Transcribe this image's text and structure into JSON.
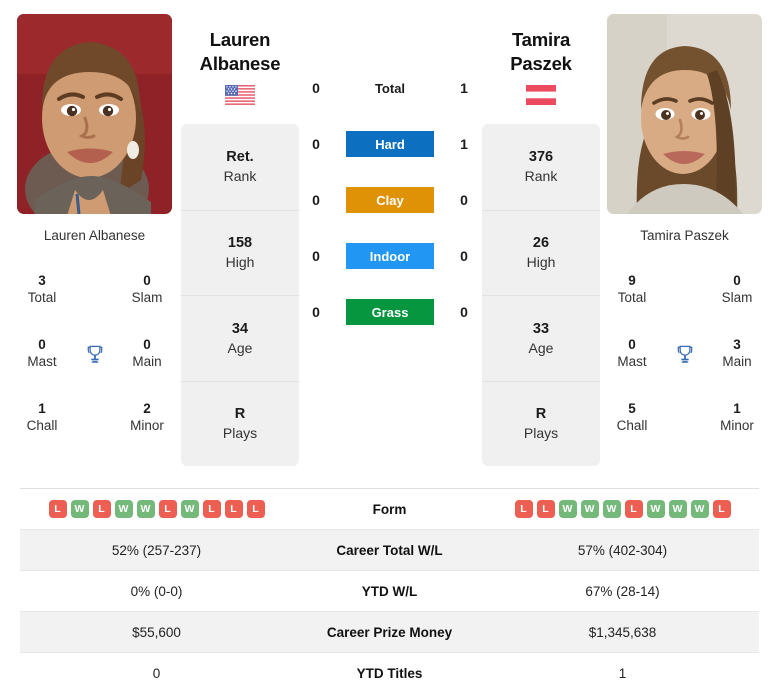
{
  "players": {
    "left": {
      "first_name": "Lauren",
      "last_name": "Albanese",
      "full_name": "Lauren Albanese",
      "country": "USA",
      "flag_icon": "flag-usa-icon",
      "photo_alt": "lauren-albanese-photo",
      "titles": {
        "total_value": "3",
        "total_label": "Total",
        "slam_value": "0",
        "slam_label": "Slam",
        "mast_value": "0",
        "mast_label": "Mast",
        "main_value": "0",
        "main_label": "Main",
        "chall_value": "1",
        "chall_label": "Chall",
        "minor_value": "2",
        "minor_label": "Minor",
        "trophy_icon": "trophy-icon"
      },
      "info": [
        {
          "value": "Ret.",
          "label": "Rank"
        },
        {
          "value": "158",
          "label": "High"
        },
        {
          "value": "34",
          "label": "Age"
        },
        {
          "value": "R",
          "label": "Plays"
        }
      ],
      "form": [
        "L",
        "W",
        "L",
        "W",
        "W",
        "L",
        "W",
        "L",
        "L",
        "L"
      ],
      "career_total_wl": "52% (257-237)",
      "ytd_wl": "0% (0-0)",
      "career_prize_money": "$55,600",
      "ytd_titles": "0"
    },
    "right": {
      "first_name": "Tamira",
      "last_name": "Paszek",
      "full_name": "Tamira Paszek",
      "country": "AUT",
      "flag_icon": "flag-austria-icon",
      "photo_alt": "tamira-paszek-photo",
      "titles": {
        "total_value": "9",
        "total_label": "Total",
        "slam_value": "0",
        "slam_label": "Slam",
        "mast_value": "0",
        "mast_label": "Mast",
        "main_value": "3",
        "main_label": "Main",
        "chall_value": "5",
        "chall_label": "Chall",
        "minor_value": "1",
        "minor_label": "Minor",
        "trophy_icon": "trophy-icon"
      },
      "info": [
        {
          "value": "376",
          "label": "Rank"
        },
        {
          "value": "26",
          "label": "High"
        },
        {
          "value": "33",
          "label": "Age"
        },
        {
          "value": "R",
          "label": "Plays"
        }
      ],
      "form": [
        "L",
        "L",
        "W",
        "W",
        "W",
        "L",
        "W",
        "W",
        "W",
        "L"
      ],
      "career_total_wl": "57% (402-304)",
      "ytd_wl": "67% (28-14)",
      "career_prize_money": "$1,345,638",
      "ytd_titles": "1"
    }
  },
  "head_to_head": {
    "total": {
      "label": "Total",
      "left": "0",
      "right": "1"
    },
    "surfaces": [
      {
        "label": "Hard",
        "left": "0",
        "right": "1",
        "color": "#0d6fbf"
      },
      {
        "label": "Clay",
        "left": "0",
        "right": "0",
        "color": "#e09207"
      },
      {
        "label": "Indoor",
        "left": "0",
        "right": "0",
        "color": "#2196f3"
      },
      {
        "label": "Grass",
        "left": "0",
        "right": "0",
        "color": "#069640"
      }
    ]
  },
  "stats_table": {
    "rows": [
      {
        "label": "Form",
        "key": "form",
        "type": "form"
      },
      {
        "label": "Career Total W/L",
        "key": "career_total_wl",
        "type": "text"
      },
      {
        "label": "YTD W/L",
        "key": "ytd_wl",
        "type": "text"
      },
      {
        "label": "Career Prize Money",
        "key": "career_prize_money",
        "type": "text"
      },
      {
        "label": "YTD Titles",
        "key": "ytd_titles",
        "type": "text"
      }
    ]
  },
  "colors": {
    "win": "#74b97a",
    "loss": "#ec5f52",
    "card_bg": "#f0f0f0",
    "row_shade": "#f2f2f2",
    "trophy": "#3d6fb4"
  }
}
